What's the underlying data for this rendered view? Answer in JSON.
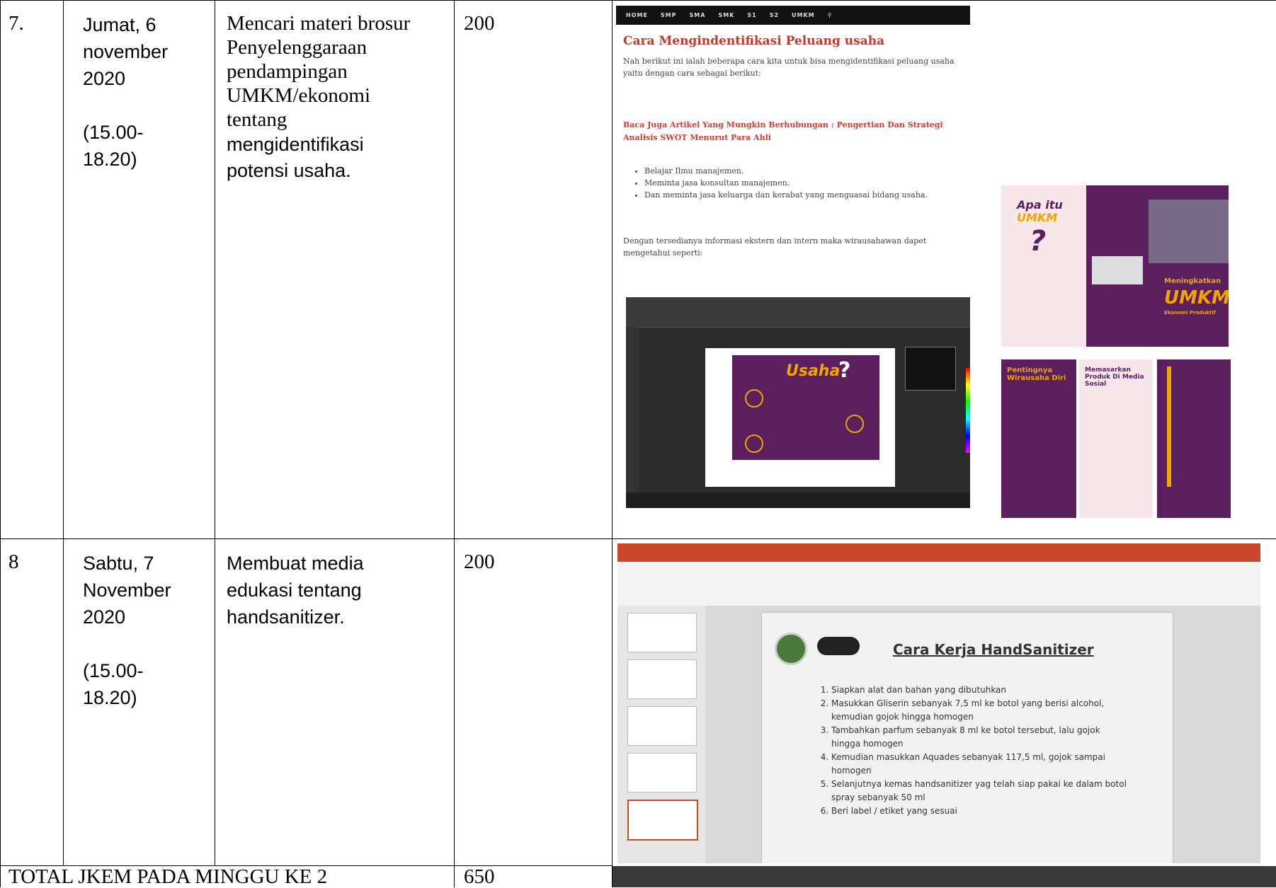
{
  "rows": [
    {
      "no": "7.",
      "day_lines": [
        "Jumat, 6",
        "november",
        "2020"
      ],
      "time_lines": [
        "(15.00-",
        "18.20)"
      ],
      "activity_lines_serif": [
        "Mencari materi brosur",
        "Penyelenggaraan",
        "pendampingan",
        "UMKM/ekonomi",
        "tentang"
      ],
      "activity_lines_sans": [
        "mengidentifikasi",
        "potensi usaha."
      ],
      "jkem": "200",
      "article": {
        "nav": [
          "HOME",
          "SMP",
          "SMA",
          "SMK",
          "S1",
          "S2",
          "UMKM"
        ],
        "heading": "Cara Mengindentifikasi Peluang usaha",
        "intro": "Nah berikut ini ialah beberapa cara kita untuk bisa mengidentifikasi peluang usaha yaitu dengan cara sebagai berikut:",
        "red_link": "Baca Juga Artikel Yang Mungkin Berhubungan : Pengertian Dan Strategi Analisis SWOT Menurut Para Ahli",
        "bullets": [
          "Belajar Ilmu manajemen.",
          "Meminta jasa konsultan manajemen.",
          "Dan meminta jasa keluarga dan kerabat yang menguasai bidang usaha."
        ],
        "outro": "Dengan tersedianya informasi ekstern dan intern maka wirausahawan dapet mengetahui seperti:"
      },
      "brochure": {
        "front_heading_1": "Apa itu",
        "front_heading_2": "UMKM",
        "front_mark": "?",
        "back_heading_1": "Meningkatkan",
        "back_heading_2": "UMKM",
        "back_heading_3": "Ekonomi Produktif",
        "panel_1": "Pentingnya Wirausaha Diri",
        "panel_2": "Memasarkan Produk Di Media Sosial",
        "panel_3": "Usaha"
      },
      "design_title": "Usaha"
    },
    {
      "no": "8",
      "day_lines": [
        "Sabtu, 7",
        "November",
        "2020"
      ],
      "time_lines": [
        "(15.00-",
        "18.20)"
      ],
      "activity_lines_sans": [
        "Membuat media",
        "edukasi tentang",
        "handsanitizer."
      ],
      "jkem": "200",
      "slide": {
        "title": "Cara Kerja HandSanitizer",
        "steps": [
          "Siapkan alat dan bahan yang dibutuhkan",
          "Masukkan Gliserin sebanyak 7,5 ml ke botol yang berisi alcohol, kemudian gojok hingga homogen",
          "Tambahkan parfum sebanyak 8 ml ke botol tersebut, lalu gojok hingga homogen",
          "Kemudian masukkan Aquades sebanyak 117,5 ml, gojok sampai homogen",
          "Selanjutnya kemas handsanitizer yag telah siap pakai ke dalam botol spray sebanyak 50 ml",
          "Beri label / etiket yang sesuai"
        ]
      }
    }
  ],
  "total": {
    "label": "TOTAL JKEM PADA MINGGU KE 2",
    "value": "650"
  },
  "colors": {
    "purple": "#5b1f5e",
    "accent_orange": "#f0a500",
    "article_red": "#c0392b",
    "ppt_orange": "#c9472b"
  }
}
